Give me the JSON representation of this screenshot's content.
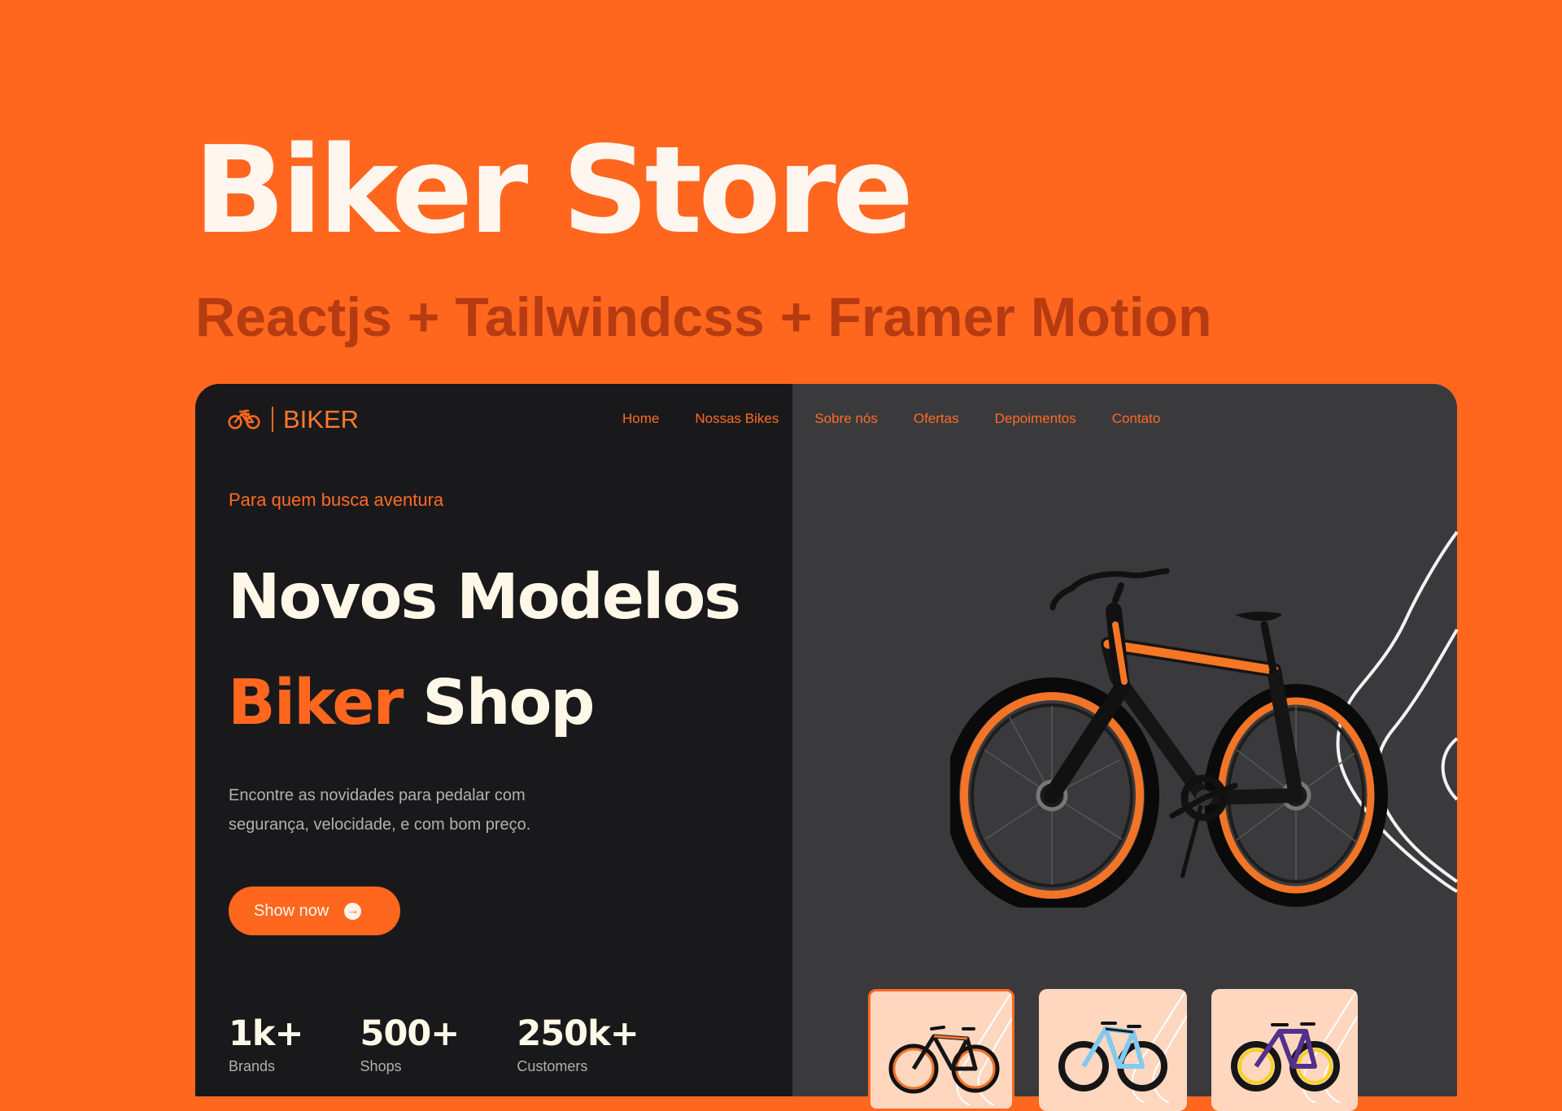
{
  "cover": {
    "title": "Biker Store",
    "subtitle": "Reactjs + Tailwindcss + Framer Motion"
  },
  "site": {
    "brand": "BIKER",
    "nav": [
      "Home",
      "Nossas Bikes",
      "Sobre nós",
      "Ofertas",
      "Depoimentos",
      "Contato"
    ],
    "hero": {
      "tagline": "Para quem busca aventura",
      "headline_line_1": "Novos Modelos",
      "headline_accent": "Biker",
      "headline_rest": "Shop",
      "description": "Encontre as novidades para pedalar com segurança, velocidade, e com bom preço.",
      "button_label": "Show now"
    },
    "stats": [
      {
        "value": "1k+",
        "label": "Brands"
      },
      {
        "value": "500+",
        "label": "Shops"
      },
      {
        "value": "250k+",
        "label": "Customers"
      }
    ],
    "icons": {
      "logo": "bicycle-icon",
      "button": "arrow-right-icon",
      "hero_image": "orange-black-bicycle",
      "thumbnail_1": "orange-black-bicycle",
      "thumbnail_2": "light-blue-mountain-bicycle",
      "thumbnail_3": "purple-yellow-mountain-bicycle"
    },
    "colors": {
      "accent": "#ff671f",
      "dark_panel": "#19191b",
      "gray_panel": "#3a3a3c",
      "thumbnail_background": "#ffd7bf",
      "cream_text": "#fff8e8"
    }
  }
}
